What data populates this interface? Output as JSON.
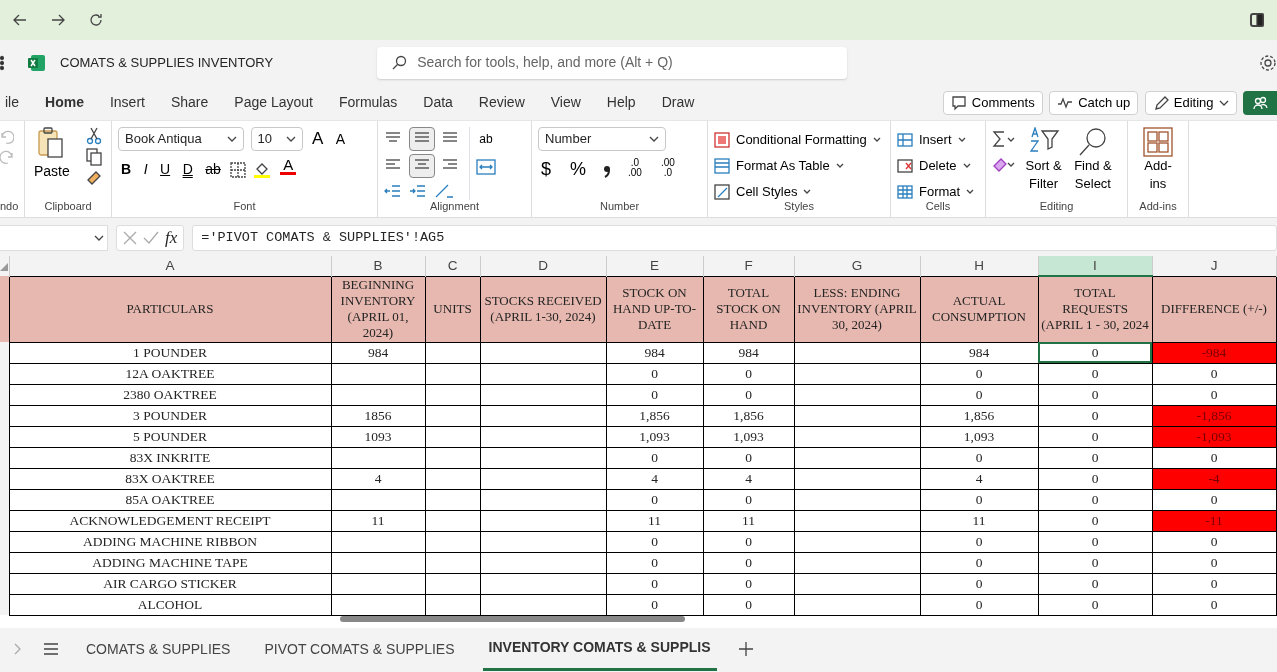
{
  "app": {
    "title": "COMATS & SUPPLIES INVENTORY",
    "search": {
      "placeholder": "Search for tools, help, and more (Alt + Q)"
    }
  },
  "menu_tabs": [
    {
      "label": "ile",
      "selected": false
    },
    {
      "label": "Home",
      "selected": true
    },
    {
      "label": "Insert",
      "selected": false
    },
    {
      "label": "Share",
      "selected": false
    },
    {
      "label": "Page Layout",
      "selected": false
    },
    {
      "label": "Formulas",
      "selected": false
    },
    {
      "label": "Data",
      "selected": false
    },
    {
      "label": "Review",
      "selected": false
    },
    {
      "label": "View",
      "selected": false
    },
    {
      "label": "Help",
      "selected": false
    },
    {
      "label": "Draw",
      "selected": false
    }
  ],
  "actions": [
    {
      "kind": "comments",
      "label": "Comments"
    },
    {
      "kind": "catchup",
      "label": "Catch up"
    },
    {
      "kind": "editing",
      "label": "Editing"
    }
  ],
  "ribbon": {
    "undo": {
      "group": "ndo"
    },
    "clipboard": {
      "paste": "Paste",
      "group": "Clipboard"
    },
    "font": {
      "name": "Book Antiqua",
      "size": "10",
      "grow": "A",
      "shrink": "A",
      "bold": "B",
      "italic": "I",
      "underline": "U",
      "double_underline": "D",
      "strike": "ab",
      "color_letter": "A",
      "group": "Font"
    },
    "alignment": {
      "wrap": "ab",
      "group": "Alignment"
    },
    "number": {
      "format": "Number",
      "currency": "$",
      "percent": "%",
      "decrease": [
        ".0",
        ".00"
      ],
      "increase": [
        ".00",
        ".0"
      ],
      "group": "Number"
    },
    "styles": {
      "items": [
        "Conditional Formatting",
        "Format As Table",
        "Cell Styles"
      ],
      "group": "Styles"
    },
    "cells": {
      "items": [
        "Insert",
        "Delete",
        "Format"
      ],
      "group": "Cells"
    },
    "editing": {
      "sort": [
        "Sort &",
        "Filter"
      ],
      "find": [
        "Find &",
        "Select"
      ],
      "group": "Editing"
    },
    "addins": {
      "label": "Add-ins",
      "group": "Add-ins"
    }
  },
  "formula_bar": {
    "fx": "fx",
    "formula": "='PIVOT COMATS & SUPPLIES'!AG5"
  },
  "columns": [
    {
      "letter": "A",
      "selected": false
    },
    {
      "letter": "B",
      "selected": false
    },
    {
      "letter": "C",
      "selected": false
    },
    {
      "letter": "D",
      "selected": false
    },
    {
      "letter": "E",
      "selected": false
    },
    {
      "letter": "F",
      "selected": false
    },
    {
      "letter": "G",
      "selected": false
    },
    {
      "letter": "H",
      "selected": false
    },
    {
      "letter": "I",
      "selected": true
    },
    {
      "letter": "J",
      "selected": false
    }
  ],
  "headers": [
    "PARTICULARS",
    "BEGINNING INVENTORY (APRIL 01, 2024)",
    "UNITS",
    "STOCKS RECEIVED (APRIL 1-30, 2024)",
    "STOCK ON HAND UP-TO-DATE",
    "TOTAL STOCK ON HAND",
    "LESS: ENDING INVENTORY (APRIL 30, 2024)",
    "ACTUAL CONSUMPTION",
    "TOTAL REQUESTS (APRIL 1 - 30, 2024",
    "DIFFERENCE (+/-)"
  ],
  "rows": [
    {
      "name": "1 POUNDER",
      "beginning": "984",
      "on_hand": "984",
      "total": "984",
      "consumption": "984",
      "requests": "0",
      "difference": "-984",
      "negative": true,
      "selected": true
    },
    {
      "name": "12A OAKTREE",
      "on_hand": "0",
      "total": "0",
      "consumption": "0",
      "requests": "0",
      "difference": "0",
      "negative": false,
      "selected": false
    },
    {
      "name": "2380 OAKTREE",
      "on_hand": "0",
      "total": "0",
      "consumption": "0",
      "requests": "0",
      "difference": "0",
      "negative": false,
      "selected": false
    },
    {
      "name": "3 POUNDER",
      "beginning": "1856",
      "on_hand": "1,856",
      "total": "1,856",
      "consumption": "1,856",
      "requests": "0",
      "difference": "-1,856",
      "negative": true,
      "selected": false
    },
    {
      "name": "5 POUNDER",
      "beginning": "1093",
      "on_hand": "1,093",
      "total": "1,093",
      "consumption": "1,093",
      "requests": "0",
      "difference": "-1,093",
      "negative": true,
      "selected": false
    },
    {
      "name": "83X INKRITE",
      "on_hand": "0",
      "total": "0",
      "consumption": "0",
      "requests": "0",
      "difference": "0",
      "negative": false,
      "selected": false
    },
    {
      "name": "83X OAKTREE",
      "beginning": "4",
      "on_hand": "4",
      "total": "4",
      "consumption": "4",
      "requests": "0",
      "difference": "-4",
      "negative": true,
      "selected": false
    },
    {
      "name": "85A OAKTREE",
      "on_hand": "0",
      "total": "0",
      "consumption": "0",
      "requests": "0",
      "difference": "0",
      "negative": false,
      "selected": false
    },
    {
      "name": "ACKNOWLEDGEMENT RECEIPT",
      "beginning": "11",
      "on_hand": "11",
      "total": "11",
      "consumption": "11",
      "requests": "0",
      "difference": "-11",
      "negative": true,
      "selected": false
    },
    {
      "name": "ADDING MACHINE RIBBON",
      "on_hand": "0",
      "total": "0",
      "consumption": "0",
      "requests": "0",
      "difference": "0",
      "negative": false,
      "selected": false
    },
    {
      "name": "ADDING MACHINE TAPE",
      "on_hand": "0",
      "total": "0",
      "consumption": "0",
      "requests": "0",
      "difference": "0",
      "negative": false,
      "selected": false
    },
    {
      "name": "AIR CARGO STICKER",
      "on_hand": "0",
      "total": "0",
      "consumption": "0",
      "requests": "0",
      "difference": "0",
      "negative": false,
      "selected": false
    },
    {
      "name": "ALCOHOL",
      "on_hand": "0",
      "total": "0",
      "consumption": "0",
      "requests": "0",
      "difference": "0",
      "negative": false,
      "selected": false
    }
  ],
  "sheet_tabs": [
    {
      "label": "COMATS & SUPPLIES",
      "selected": false
    },
    {
      "label": "PIVOT COMATS & SUPPLIES",
      "selected": false
    },
    {
      "label": "INVENTORY COMATS & SUPPLIS",
      "selected": true
    }
  ]
}
